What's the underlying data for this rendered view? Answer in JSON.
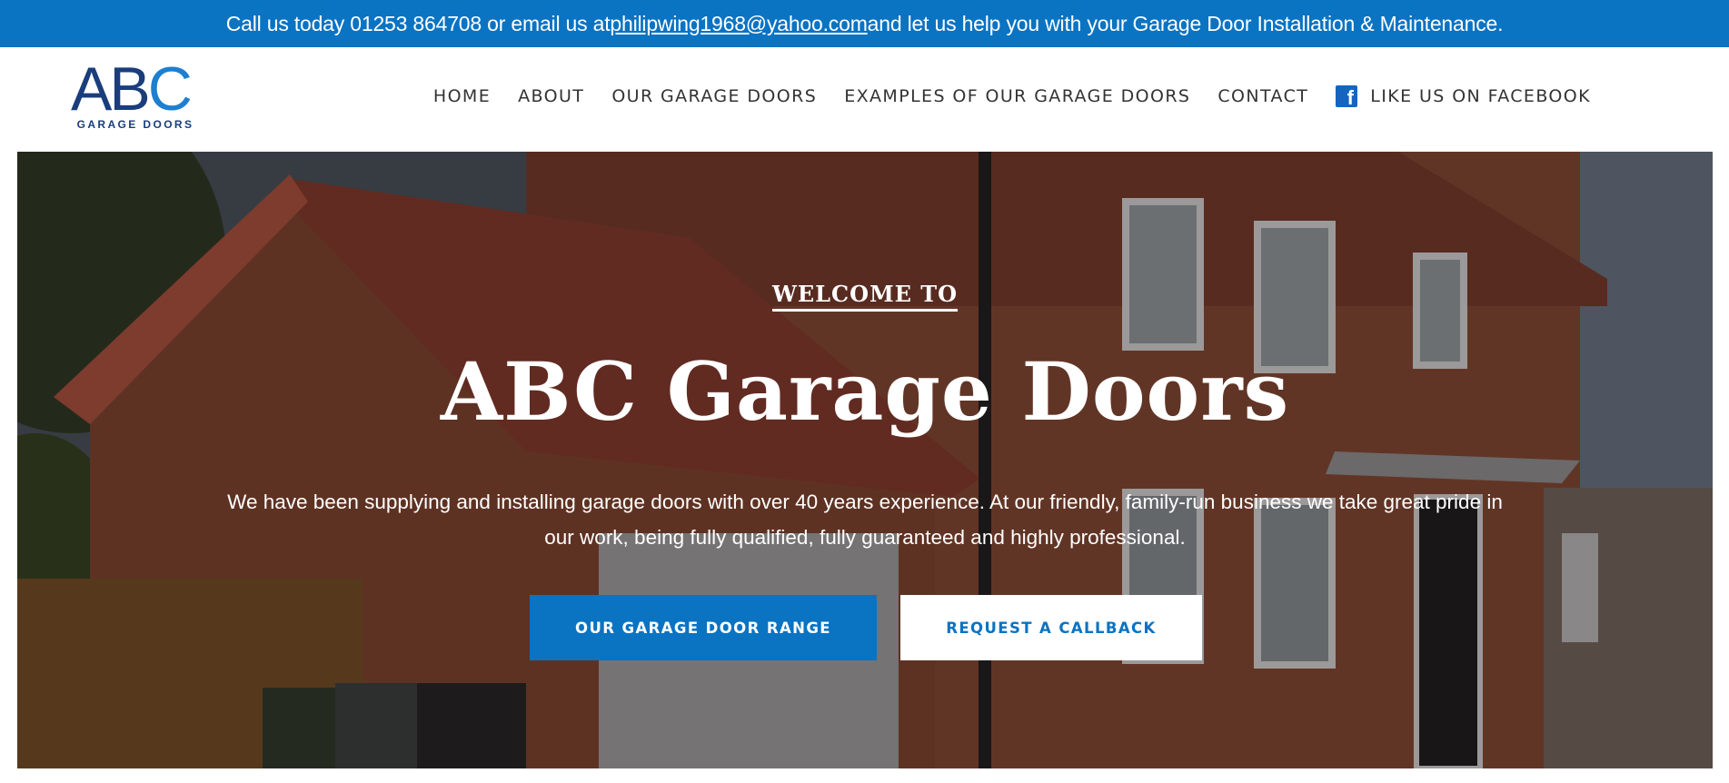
{
  "topbar": {
    "before": "Call us today 01253 864708 or email us at ",
    "email": "philipwing1968@yahoo.com",
    "after": " and let us help you with your Garage Door Installation & Maintenance."
  },
  "logo": {
    "ab": "AB",
    "c": "C",
    "sub": "GARAGE DOORS"
  },
  "nav": {
    "items": [
      {
        "label": "HOME"
      },
      {
        "label": "ABOUT"
      },
      {
        "label": "OUR GARAGE DOORS"
      },
      {
        "label": "EXAMPLES OF OUR GARAGE DOORS"
      },
      {
        "label": "CONTACT"
      }
    ],
    "facebook_label": "LIKE US ON FACEBOOK",
    "facebook_icon": "facebook-icon"
  },
  "hero": {
    "welcome": "WELCOME TO",
    "title": "ABC Garage Doors",
    "description": "We have been supplying and installing garage doors with over 40 years experience. At our friendly, family-run business we take great pride in our work, being fully qualified, fully guaranteed and highly professional.",
    "primary_button": "OUR GARAGE DOOR RANGE",
    "secondary_button": "REQUEST A CALLBACK"
  },
  "colors": {
    "accent": "#0a73c2",
    "brand_dark": "#1a3d7c",
    "white": "#ffffff"
  }
}
